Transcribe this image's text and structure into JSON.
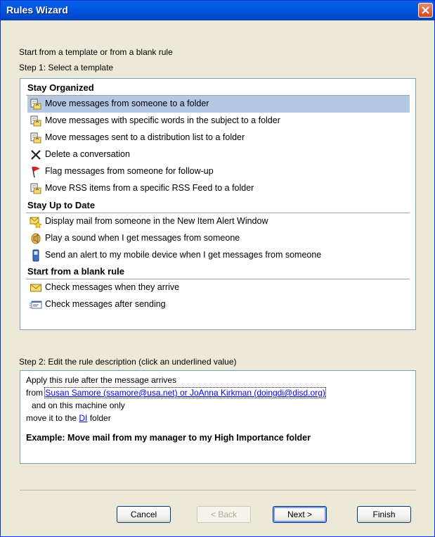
{
  "window": {
    "title": "Rules Wizard"
  },
  "intro": "Start from a template or from a blank rule",
  "step1": "Step 1: Select a template",
  "categories": [
    {
      "name": "Stay Organized",
      "items": [
        {
          "label": "Move messages from someone to a folder",
          "icon": "move-to-folder-icon",
          "selected": true
        },
        {
          "label": "Move messages with specific words in the subject to a folder",
          "icon": "move-to-folder-icon"
        },
        {
          "label": "Move messages sent to a distribution list to a folder",
          "icon": "move-to-folder-icon"
        },
        {
          "label": "Delete a conversation",
          "icon": "delete-x-icon"
        },
        {
          "label": "Flag messages from someone for follow-up",
          "icon": "red-flag-icon"
        },
        {
          "label": "Move RSS items from a specific RSS Feed to a folder",
          "icon": "move-to-folder-icon"
        }
      ]
    },
    {
      "name": "Stay Up to Date",
      "items": [
        {
          "label": "Display mail from someone in the New Item Alert Window",
          "icon": "new-item-alert-icon"
        },
        {
          "label": "Play a sound when I get messages from someone",
          "icon": "sound-speaker-icon"
        },
        {
          "label": "Send an alert to my mobile device when I get messages from someone",
          "icon": "mobile-device-icon"
        }
      ]
    },
    {
      "name": "Start from a blank rule",
      "items": [
        {
          "label": "Check messages when they arrive",
          "icon": "envelope-icon"
        },
        {
          "label": "Check messages after sending",
          "icon": "sent-message-icon"
        }
      ]
    }
  ],
  "step2": "Step 2: Edit the rule description (click an underlined value)",
  "description": {
    "line1": "Apply this rule after the message arrives",
    "from_prefix": "from ",
    "from_link": "Susan Samore (ssamore@usa.net) or JoAnna Kirkman (doingdi@disd.org)",
    "line3": "and on this machine only",
    "move_prefix": "move it to the ",
    "folder_link": "DI",
    "move_suffix": " folder",
    "example": "Example: Move mail from my manager to my High Importance folder"
  },
  "buttons": {
    "cancel": "Cancel",
    "back": "< Back",
    "next": "Next >",
    "finish": "Finish"
  }
}
